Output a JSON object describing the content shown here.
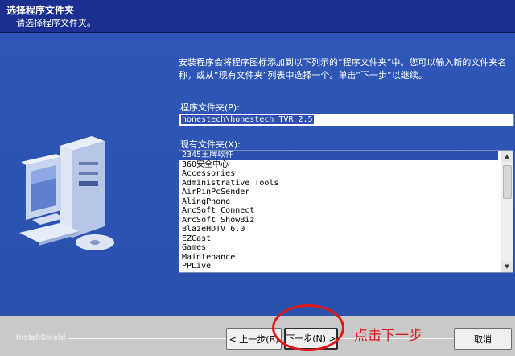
{
  "header": {
    "title": "选择程序文件夹",
    "subtitle": "请选择程序文件夹。"
  },
  "main": {
    "description": "安装程序会将程序图标添加到以下列示的“程序文件夹”中。您可以输入新的文件夹名称，或从“现有文件夹”列表中选择一个。单击“下一步”以继续。",
    "program_folder_label": "程序文件夹(P):",
    "program_folder_value": "honestech\\honestech TVR 2.5",
    "existing_folders_label": "现有文件夹(X):",
    "existing_folders": [
      "2345王牌软件",
      "360安全中心",
      "Accessories",
      "Administrative Tools",
      "AirPinPcSender",
      "AlingPhone",
      "ArcSoft Connect",
      "ArcSoft ShowBiz",
      "BlazeHDTV 6.0",
      "EZCast",
      "Games",
      "Maintenance",
      "PPLive"
    ],
    "selected_folder_index": 0
  },
  "footer": {
    "brand": "InstallShield",
    "back_label": "< 上一步(B)",
    "next_label": "下一步(N) >",
    "cancel_label": "取消"
  },
  "annotation": {
    "text": "点击下一步",
    "color": "#e01818"
  },
  "colors": {
    "header_bg": "#1a2f8f",
    "dialog_bg": "#2f57b8",
    "selection": "#2d4fb3"
  }
}
